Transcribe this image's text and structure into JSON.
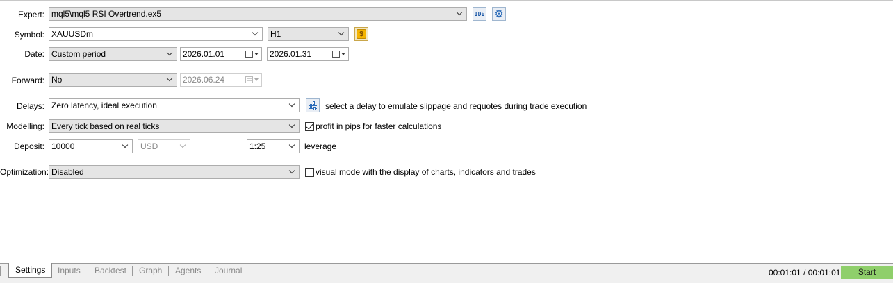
{
  "labels": {
    "expert": "Expert:",
    "symbol": "Symbol:",
    "date": "Date:",
    "forward": "Forward:",
    "delays": "Delays:",
    "modelling": "Modelling:",
    "deposit": "Deposit:",
    "optimization": "Optimization:"
  },
  "expert": {
    "value": "mql5\\mql5 RSI Overtrend.ex5",
    "ide_label": "IDE",
    "settings_icon": "gear-icon"
  },
  "symbol": {
    "value": "XAUUSDm",
    "timeframe": "H1",
    "symbol_props_icon": "coin-icon",
    "coin_glyph": "$"
  },
  "date": {
    "period": "Custom period",
    "from": "2026.01.01",
    "to": "2026.01.31"
  },
  "forward": {
    "value": "No",
    "date": "2026.06.24"
  },
  "delays": {
    "value": "Zero latency, ideal execution",
    "hint": "select a delay to emulate slippage and requotes during trade execution"
  },
  "modelling": {
    "value": "Every tick based on real ticks",
    "pips_checked": true,
    "pips_label": "profit in pips for faster calculations"
  },
  "deposit": {
    "amount": "10000",
    "currency": "USD",
    "leverage": "1:25",
    "leverage_label": "leverage"
  },
  "optimization": {
    "value": "Disabled",
    "visual_checked": false,
    "visual_label": "visual mode with the display of charts, indicators and trades"
  },
  "tabs": [
    "Settings",
    "Inputs",
    "Backtest",
    "Graph",
    "Agents",
    "Journal"
  ],
  "status": {
    "timer": "00:01:01 / 00:01:01",
    "start_label": "Start"
  },
  "colors": {
    "start_button": "#8fcf6b",
    "icon_blue": "#2a6bb8",
    "coin": "#f5b400"
  }
}
